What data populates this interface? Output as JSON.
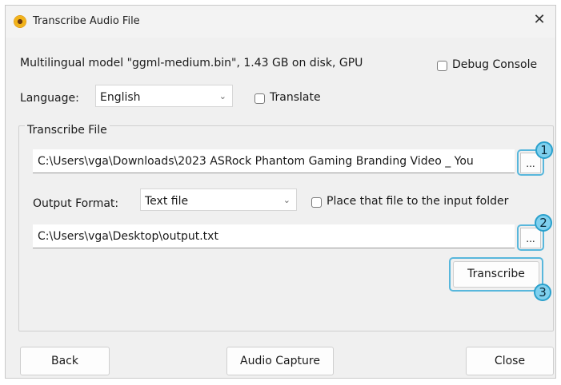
{
  "window": {
    "title": "Transcribe Audio File",
    "close_glyph": "✕",
    "icon": "app-sun-icon"
  },
  "model_info": "Multilingual model \"ggml-medium.bin\", 1.43 GB on disk, GPU",
  "debug_console": {
    "label": "Debug Console",
    "checked": false
  },
  "language": {
    "label": "Language:",
    "value": "English"
  },
  "translate": {
    "label": "Translate",
    "checked": false
  },
  "transcribe_file": {
    "group_title": "Transcribe File",
    "input_path": "C:\\Users\\vga\\Downloads\\2023 ASRock Phantom Gaming Branding Video _ You",
    "browse_label": "...",
    "output_format_label": "Output Format:",
    "output_format_value": "Text file",
    "place_in_input_folder": {
      "label": "Place that file to the input folder",
      "checked": false
    },
    "output_path": "C:\\Users\\vga\\Desktop\\output.txt",
    "transcribe_label": "Transcribe"
  },
  "annotations": [
    "1",
    "2",
    "3"
  ],
  "footer": {
    "back_label": "Back",
    "audio_capture_label": "Audio Capture",
    "close_label": "Close"
  },
  "colors": {
    "highlight": "#58b7dc",
    "badge": "#7fd0ee"
  }
}
